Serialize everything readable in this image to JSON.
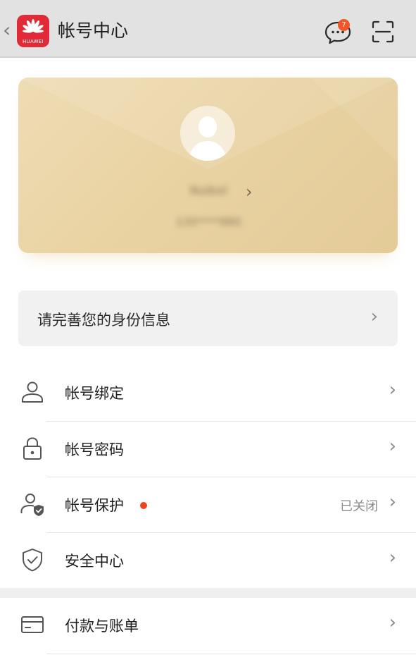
{
  "header": {
    "back_icon": "chevron-left-icon",
    "logo_text": "HUAWEI",
    "logo_color": "#e12a38",
    "title": "帐号中心",
    "message_badge": "7",
    "badge_color": "#f0562a"
  },
  "profile": {
    "username": "Ikobol",
    "phone": "130****880"
  },
  "identity_banner": {
    "label": "请完善您的身份信息"
  },
  "menu": [
    {
      "label": "帐号绑定",
      "icon": "person-icon"
    },
    {
      "label": "帐号密码",
      "icon": "lock-icon"
    },
    {
      "label": "帐号保护",
      "icon": "person-shield-icon",
      "status": "已关闭",
      "has_dot": true
    },
    {
      "label": "安全中心",
      "icon": "shield-check-icon"
    },
    {
      "label": "付款与账单",
      "icon": "card-icon"
    }
  ],
  "colors": {
    "card_gold": "#e9d3a3",
    "accent_dot": "#f0421f"
  }
}
